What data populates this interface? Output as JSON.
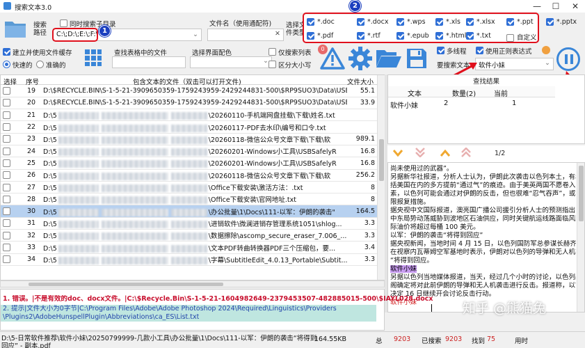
{
  "window": {
    "title": "搜索文本3.0",
    "min": "—",
    "max": "☐",
    "close": "✕"
  },
  "search": {
    "path_label": "搜索\n路径",
    "include_subdirs": "同时搜索子目录",
    "path_value": "C:\\;D:\\;E:\\;F:\\",
    "filename_label": "文件名（使用通配符)",
    "filename_value": "",
    "filetype_label": "选择文\n件类型"
  },
  "extensions": [
    {
      "label": "*.doc",
      "checked": true
    },
    {
      "label": "*.docx",
      "checked": true
    },
    {
      "label": "*.wps",
      "checked": true
    },
    {
      "label": "*.xls",
      "checked": true
    },
    {
      "label": "*.xlsx",
      "checked": true
    },
    {
      "label": "*.ppt",
      "checked": true
    },
    {
      "label": "*.pdf",
      "checked": true
    },
    {
      "label": "*.rtf",
      "checked": true
    },
    {
      "label": "*.epub",
      "checked": true
    },
    {
      "label": "*.html",
      "checked": true
    },
    {
      "label": "*.txt",
      "checked": true
    },
    {
      "label": "自定义",
      "checked": false
    }
  ],
  "ext_extra": "*.pptx",
  "options": {
    "cache": "建立并使用文件缓存",
    "fast": "快速的",
    "accurate": "准确的",
    "table_search_label": "查找表格中的文件",
    "theme_label": "选择界面配色",
    "only_list": "仅搜索列表",
    "case": "区分大小写",
    "multithread": "多线程",
    "regex": "使用正则表达式",
    "keyword_label": "要搜索文本",
    "keyword_value": "软件小妹"
  },
  "toolbar_badge": "0",
  "badges": {
    "b1": "1",
    "b2": "2",
    "b3": "3",
    "b4": "4"
  },
  "table": {
    "headers": [
      "选择",
      "序号",
      "包含文本的文件（双击可以打开文件)",
      "文件大小"
    ],
    "rows": [
      {
        "no": "19",
        "path": "D:\\$RECYCLE.BIN\\S-1-5-21-3909650359-1759243959-2429244831-500\\$RP9SUO3\\Data\\USB...",
        "size": "55.1",
        "blur": false,
        "selected": false
      },
      {
        "no": "20",
        "path": "D:\\$RECYCLE.BIN\\S-1-5-21-3909650359-1759243959-2429244831-500\\$RP9SUO3\\Data\\USB...",
        "size": "33.9",
        "blur": false,
        "selected": false
      },
      {
        "no": "21",
        "pre": "D:\\5",
        "path": "\\20260110-手机端网盘挂载\\下载\\姓名.txt",
        "size": "",
        "blur": true,
        "selected": false
      },
      {
        "no": "22",
        "pre": "D:\\5",
        "path": "\\20260117-PDF去水印\\编号和口令.txt",
        "size": "",
        "blur": true,
        "selected": false
      },
      {
        "no": "23",
        "pre": "D:\\5",
        "path": "\\20260118-微信公众号文章下载\\下载\\软",
        "size": "989.1",
        "blur": true,
        "selected": false
      },
      {
        "no": "24",
        "pre": "D:\\5",
        "path": "\\20260201-Windows小工具\\USBSafelyR",
        "size": "16.8",
        "blur": true,
        "selected": false
      },
      {
        "no": "25",
        "pre": "D:\\5",
        "path": "\\20260201-Windows小工具\\USBSafelyR",
        "size": "16.8",
        "blur": true,
        "selected": false
      },
      {
        "no": "26",
        "pre": "D:\\5",
        "path": "\\20260118-微信公众号文章下载\\下载\\软",
        "size": "256.2",
        "blur": true,
        "selected": false
      },
      {
        "no": "27",
        "pre": "D:\\5",
        "path": "\\Office下载安装\\激活方法：.txt",
        "size": "8",
        "blur": true,
        "selected": false
      },
      {
        "no": "28",
        "pre": "D:\\5",
        "path": "\\Office下载安装\\官网地址.txt",
        "size": "8",
        "blur": true,
        "selected": false
      },
      {
        "no": "30",
        "pre": "D:\\5",
        "path": "\\办公批量\\1\\Docs\\111-以军：伊朗的袭击\"",
        "size": "164.5",
        "blur": true,
        "selected": true
      },
      {
        "no": "31",
        "pre": "D:\\5",
        "path": "\\进销软件\\微澜进销存管理系统1051\\shlog...",
        "size": "3.3",
        "blur": true,
        "selected": false
      },
      {
        "no": "32",
        "pre": "D:\\5",
        "path": "\\数据擦除\\ascomp_secure_eraser_7.006_...",
        "size": "3.3",
        "blur": true,
        "selected": false
      },
      {
        "no": "33",
        "pre": "D:\\5",
        "path": "\\文本PDF转曲转换器PDF三个压缩包，要...",
        "size": "3.4",
        "blur": true,
        "selected": false
      },
      {
        "no": "34",
        "pre": "D:\\5",
        "path": "\\字幕\\SubtitleEdit_4.0.13_Portable\\Subtit...",
        "size": "3.3",
        "blur": true,
        "selected": false
      }
    ]
  },
  "results": {
    "title": "查找结果",
    "headers": [
      "文本",
      "数量(2)",
      "当前"
    ],
    "rows": [
      {
        "text": "软件小妹",
        "count": "2",
        "current": "1"
      }
    ]
  },
  "nav": {
    "page": "1/2"
  },
  "preview": [
    {
      "t": "尚未使用过的武器”。",
      "hl": false
    },
    {
      "t": "另据新华社报道，分析人士认为，伊朗此次袭击以色列本土，有着",
      "hl": false
    },
    {
      "t": "括美国在内的多方提前“通过气”的痕迹。由于美英两国不愿卷入中东",
      "hl": false
    },
    {
      "t": "素，以色列可能会通过对伊朗的反击，但也很难“忍气吞声”，或将采",
      "hl": false
    },
    {
      "t": "限报复措施。",
      "hl": false
    },
    {
      "t": "据央视中文国际报道，澳亮国广播公司援引分析人士的预测指出，以",
      "hl": false
    },
    {
      "t": "中东局势动荡威胁到波地区石油供应，同时关键航运线路面临风险",
      "hl": false
    },
    {
      "t": "际油价将超过每桶 100 美元。",
      "hl": false
    },
    {
      "t": "以军：伊朗的袭击“将得到回应”",
      "hl": false
    },
    {
      "t": "据央视新闻，当地时间 4 月 15 日，以色列国防军总参谋长赫齐·哈",
      "hl": false
    },
    {
      "t": "在视察内瓦蒂姆空军基地时表示，伊朗对以色列的导弹和无人机袭",
      "hl": false
    },
    {
      "t": "“将得到回应。",
      "hl": false
    },
    {
      "t": "软件小妹",
      "hl": true
    },
    {
      "t": "另据以色列当地媒体报道，当天，经过几个小时的讨论，以色列战",
      "hl": false
    },
    {
      "t": "阁确定将对此前伊朗的导弹和无人机袭击进行反击。报道称，以官",
      "hl": false
    },
    {
      "t": "决定 16 日继续开会讨论反击行动。",
      "hl": false
    },
    {
      "t": "软件小妹",
      "hl": true
    }
  ],
  "log": [
    "1. 错误。|不是有效的doc、docx文件。|C:\\$Recycle.Bin\\S-1-5-21-1604982649-2379453507-482885015-500\\$IAYL028.docx",
    "2. 提示|文件大小为0字节|C:\\Program Files\\Adobe\\Adobe Photoshop 2024\\Required\\Linguistics\\Providers",
    "\\Plugins2\\AdobeHunspellPlugin\\Abbreviations\\ca_ES\\List.txt"
  ],
  "status": {
    "path_line1": "D:\\5-日常软件推荐\\软件小妹\\20250799999-几款小工具\\办公批量\\1\\Docs\\111-以军：伊朗的袭击“将得到",
    "path_line2": "回应” - 副本.pdf",
    "size": "164.55KB",
    "total_label": "总",
    "total": "9203",
    "searched_label": "已搜索",
    "searched": "9203",
    "found_label": "找到",
    "found": "75",
    "time_label": "用时"
  },
  "watermark": "知乎 @熊猫兔"
}
